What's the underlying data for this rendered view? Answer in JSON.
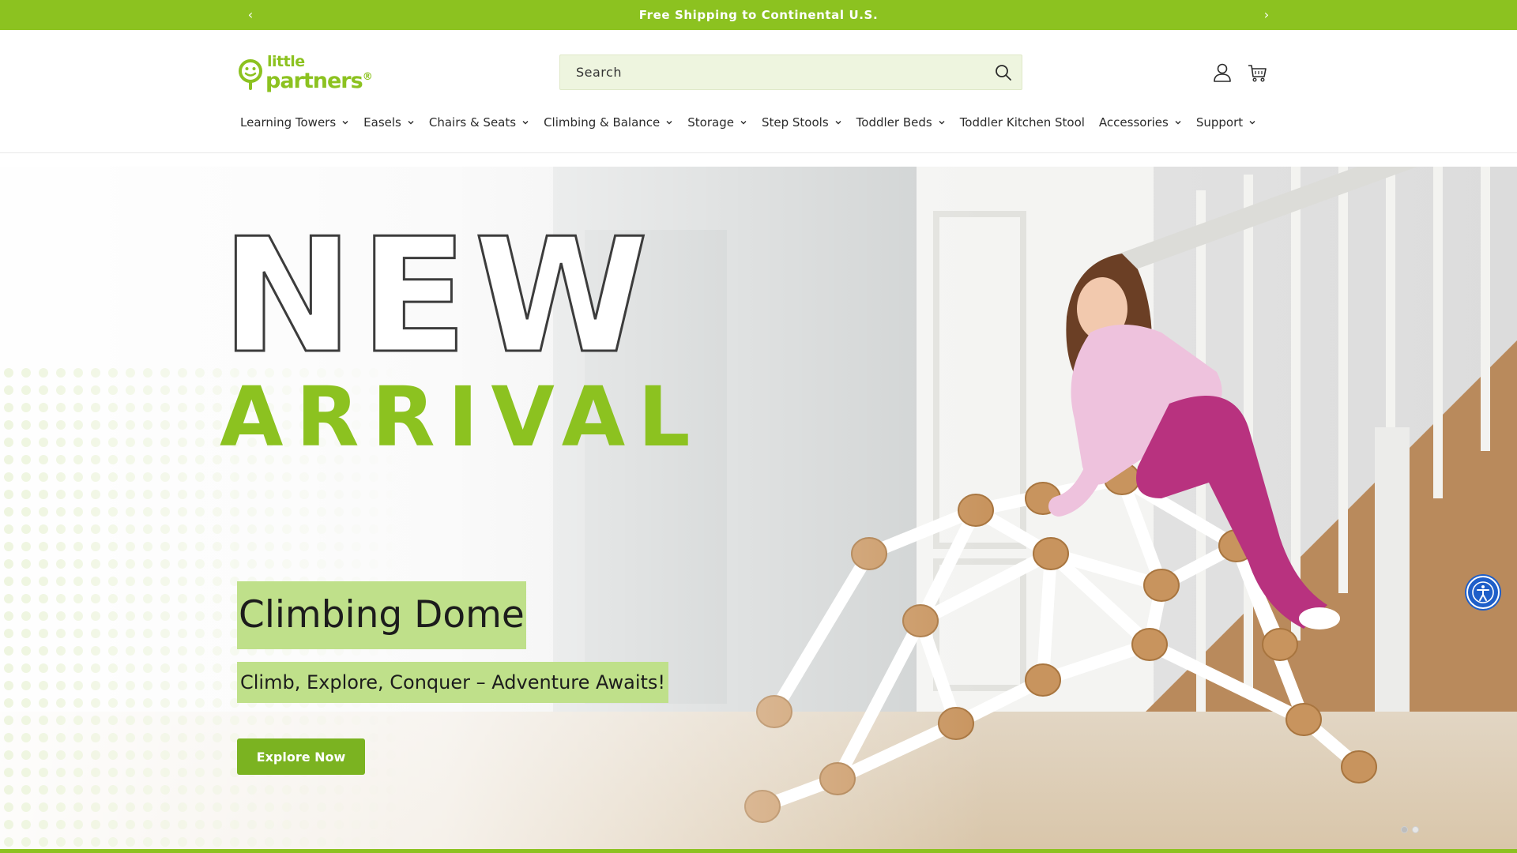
{
  "announcement": {
    "text": "Free Shipping to Continental U.S.",
    "prev_icon": "chevron-left-icon",
    "next_icon": "chevron-right-icon"
  },
  "brand": {
    "logo_top": "little",
    "logo_main": "partners",
    "logo_reg": "®",
    "color": "#8cc220"
  },
  "search": {
    "placeholder": "Search",
    "icon": "search-icon"
  },
  "header_icons": {
    "account": "user-icon",
    "cart": "cart-icon"
  },
  "nav": {
    "items": [
      {
        "label": "Learning Towers",
        "has_dropdown": true
      },
      {
        "label": "Easels",
        "has_dropdown": true
      },
      {
        "label": "Chairs & Seats",
        "has_dropdown": true
      },
      {
        "label": "Climbing & Balance",
        "has_dropdown": true
      },
      {
        "label": "Storage",
        "has_dropdown": true
      },
      {
        "label": "Step Stools",
        "has_dropdown": true
      },
      {
        "label": "Toddler Beds",
        "has_dropdown": true
      },
      {
        "label": "Toddler Kitchen Stool",
        "has_dropdown": false
      },
      {
        "label": "Accessories",
        "has_dropdown": true
      },
      {
        "label": "Support",
        "has_dropdown": true
      }
    ]
  },
  "hero": {
    "headline_outline": "NEW",
    "headline_fill": "ARRIVAL",
    "title": "Climbing Dome",
    "subtitle": "Climb, Explore, Conquer – Adventure Awaits!",
    "cta_label": "Explore Now",
    "slide_count": 2,
    "active_slide": 1
  },
  "colors": {
    "accent": "#8cc220",
    "highlight": "#bfe08a",
    "accessibility": "#1f5fc9"
  }
}
